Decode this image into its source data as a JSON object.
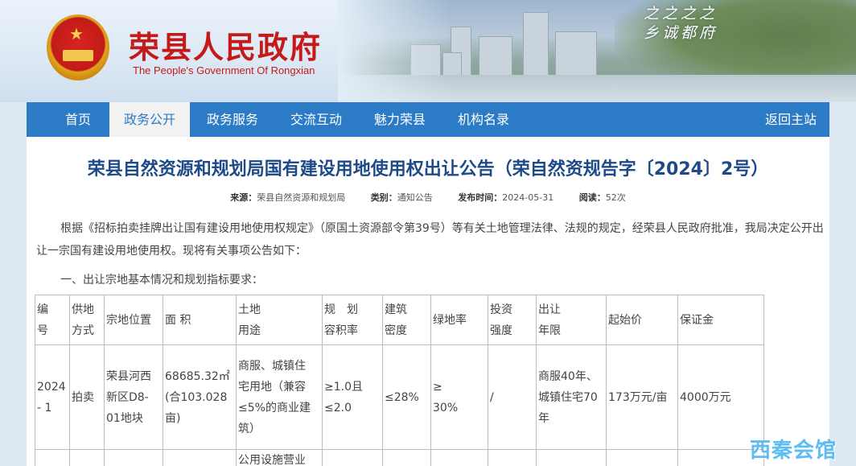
{
  "header": {
    "site_title": "荣县人民政府",
    "site_title_en": "The People's Government Of Rongxian",
    "slogan_line1": "之之之之",
    "slogan_line2": "乡诚都府"
  },
  "nav": {
    "items": [
      "首页",
      "政务公开",
      "政务服务",
      "交流互动",
      "魅力荣县",
      "机构名录"
    ],
    "active_index": 1,
    "back_home": "返回主站"
  },
  "article": {
    "title": "荣县自然资源和规划局国有建设用地使用权出让公告（荣自然资规告字〔2024〕2号）",
    "meta": {
      "source_label": "来源：",
      "source": "荣县自然资源和规划局",
      "category_label": "类别：",
      "category": "通知公告",
      "date_label": "发布时间：",
      "date": "2024-05-31",
      "views_label": "阅读：",
      "views": "52次"
    },
    "para1": "根据《招标拍卖挂牌出让国有建设用地使用权规定》（原国土资源部令第39号）等有关土地管理法律、法规的规定，经荣县人民政府批准，我局决定公开出让一宗国有建设用地使用权。现将有关事项公告如下：",
    "section1": "一、出让宗地基本情况和规划指标要求："
  },
  "table": {
    "headers": [
      {
        "l1": "编",
        "l2": "号"
      },
      {
        "l1": "供地",
        "l2": "方式"
      },
      {
        "l1": "宗地位置",
        "l2": ""
      },
      {
        "l1": "面 积",
        "l2": ""
      },
      {
        "l1": "土地",
        "l2": "用途"
      },
      {
        "l1": "规　划",
        "l2": "容积率"
      },
      {
        "l1": "建筑",
        "l2": "密度"
      },
      {
        "l1": "绿地率",
        "l2": ""
      },
      {
        "l1": "投资",
        "l2": "强度"
      },
      {
        "l1": "出让",
        "l2": "年限"
      },
      {
        "l1": "起始价",
        "l2": ""
      },
      {
        "l1": "保证金",
        "l2": ""
      }
    ],
    "row1": {
      "no": "2024\n- 1",
      "method": "拍卖",
      "location": "荣县河西\n新区D8-\n01地块",
      "area": "68685.32㎡\n(合103.028\n亩)",
      "use": "商服、城镇住\n宅用地（兼容\n≤5%的商业建\n筑）",
      "far": "≥1.0且\n≤2.0",
      "density": "≤28%",
      "green": "≥\n30%",
      "invest": "/",
      "term": "商服40年、\n城镇住宅70\n年",
      "price": "173万元/亩",
      "deposit": "4000万元"
    },
    "row2_partial_use": "公用设施营业"
  },
  "watermark": "西秦会馆"
}
